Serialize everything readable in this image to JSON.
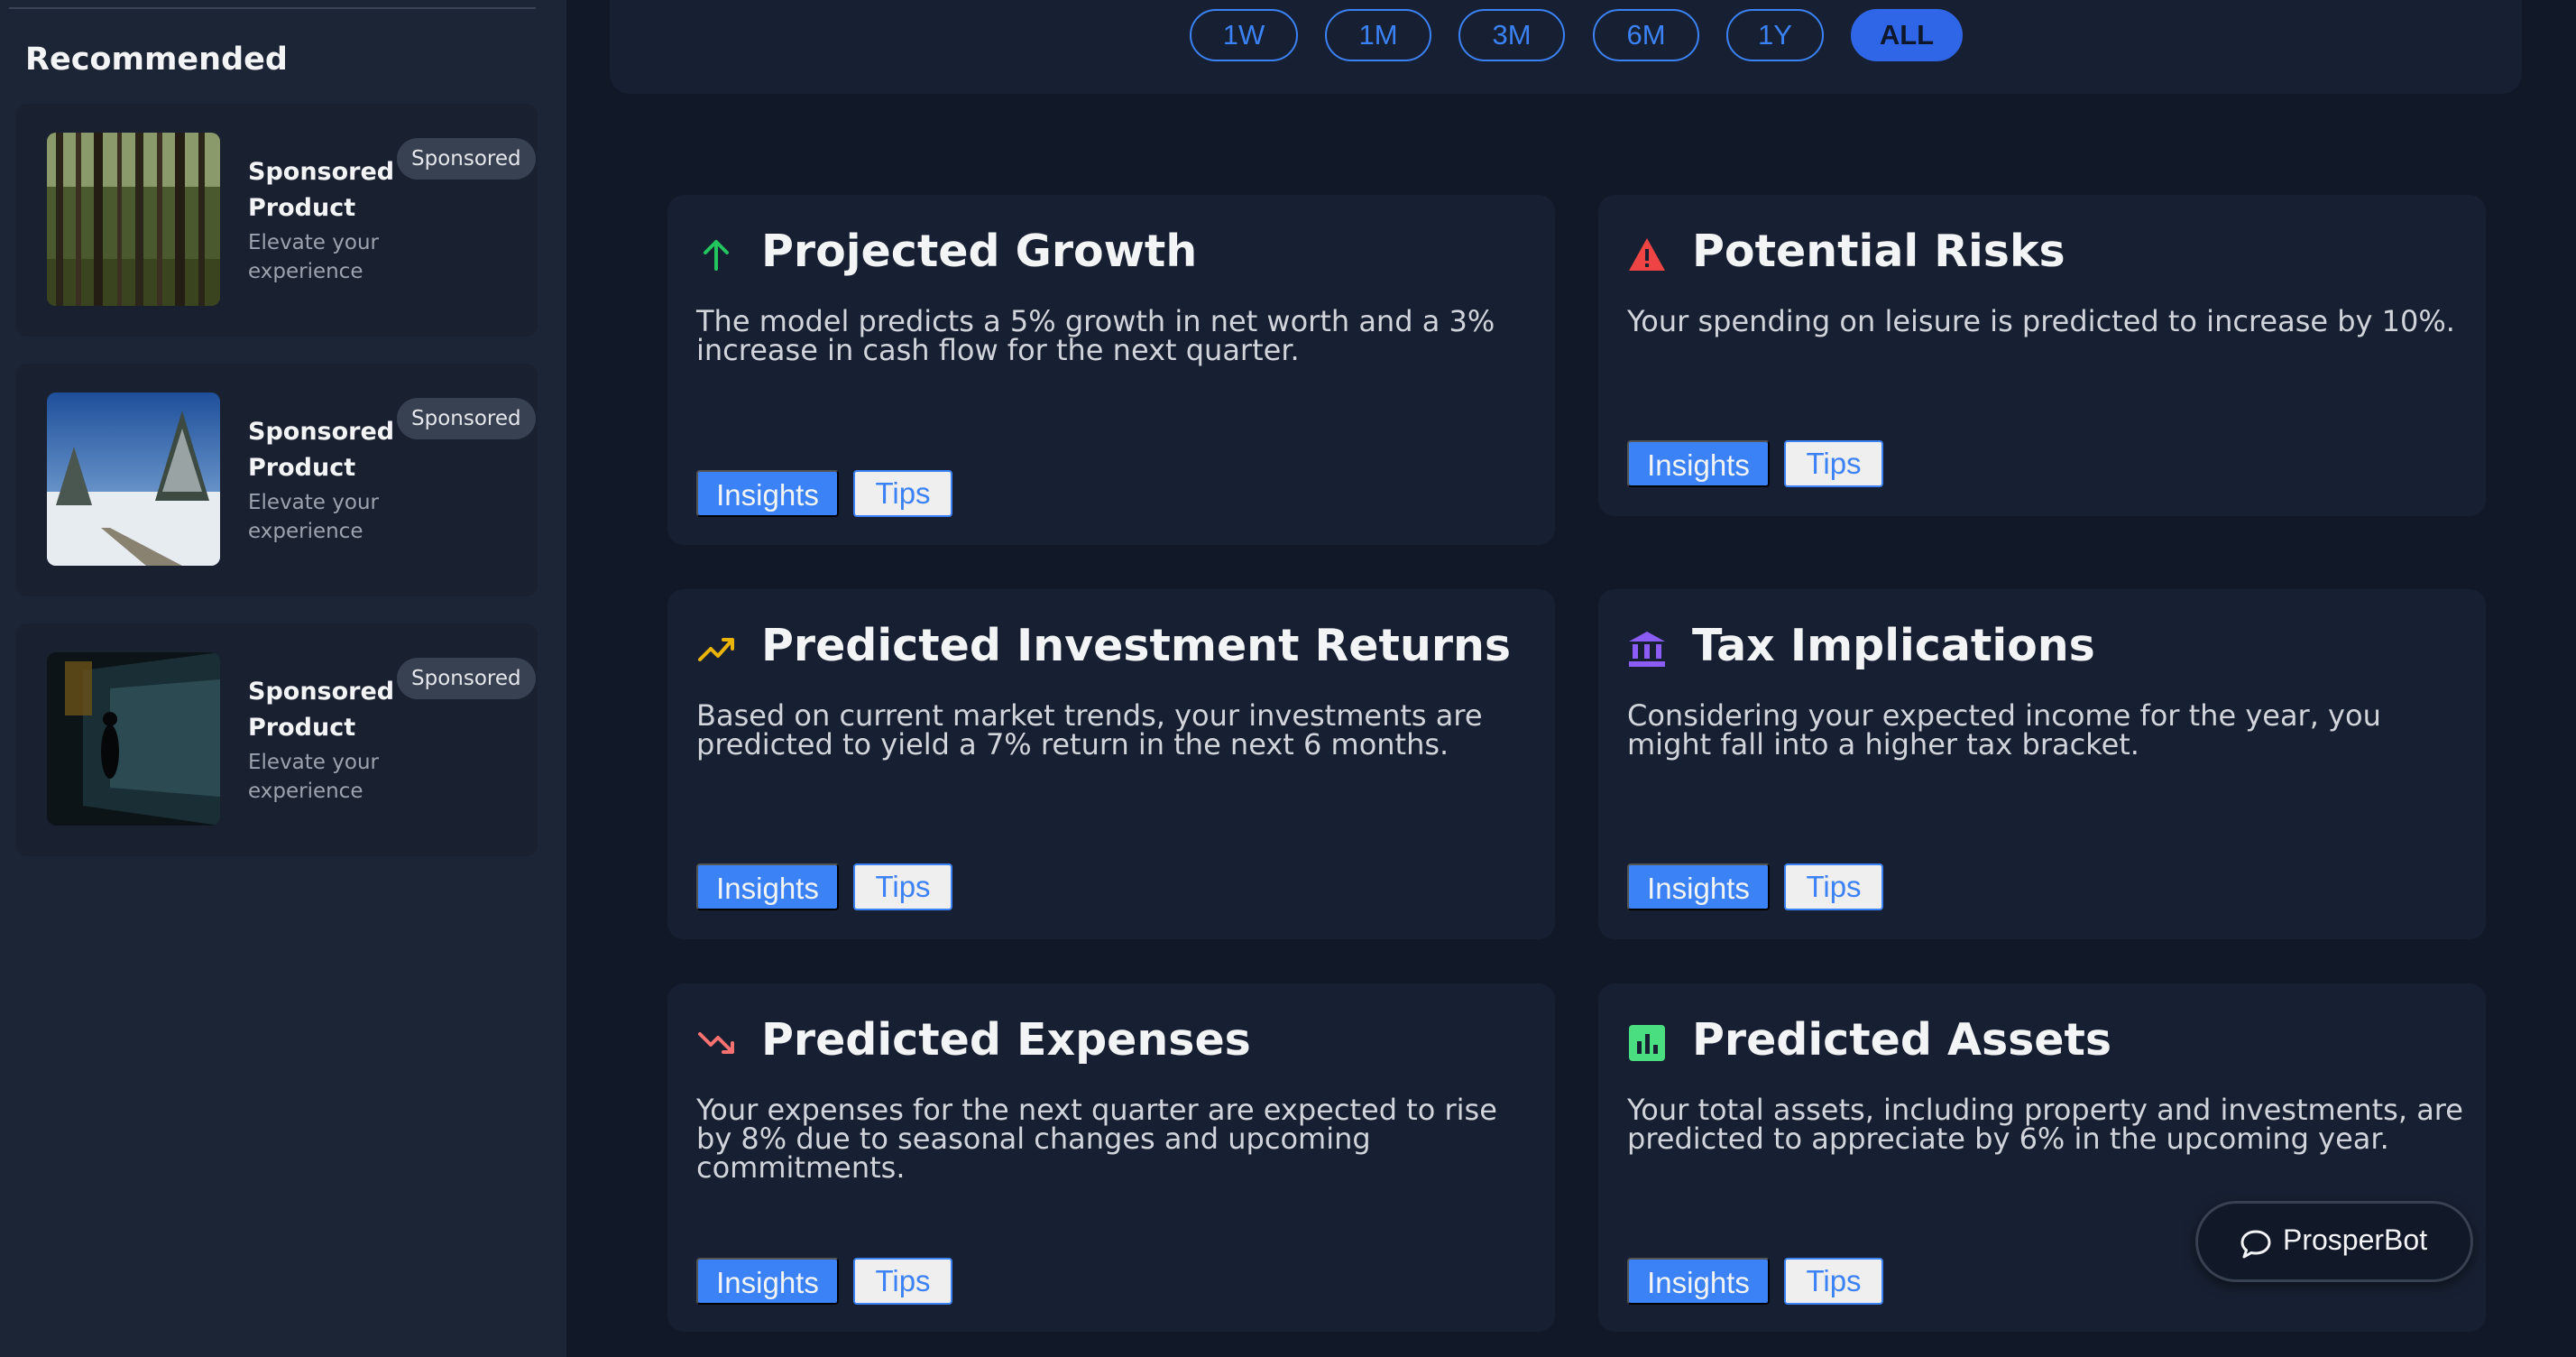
{
  "sidebar": {
    "title": "Recommended",
    "ads": [
      {
        "title": "Sponsored Product",
        "subtitle": "Elevate your experience",
        "badge": "Sponsored",
        "image": "forest-image"
      },
      {
        "title": "Sponsored Product",
        "subtitle": "Elevate your experience",
        "badge": "Sponsored",
        "image": "snowy-landscape-image"
      },
      {
        "title": "Sponsored Product",
        "subtitle": "Elevate your experience",
        "badge": "Sponsored",
        "image": "tunnel-image"
      }
    ]
  },
  "timeframes": {
    "options": [
      "1W",
      "1M",
      "3M",
      "6M",
      "1Y",
      "ALL"
    ],
    "selected": "ALL"
  },
  "cards": [
    {
      "icon": "arrow-up-icon",
      "title": "Projected Growth",
      "body": "The model predicts a 5% growth in net worth and a 3% increase in cash flow for the next quarter.",
      "insights_label": "Insights",
      "tips_label": "Tips"
    },
    {
      "icon": "warning-icon",
      "title": "Potential Risks",
      "body": "Your spending on leisure is predicted to increase by 10%.",
      "insights_label": "Insights",
      "tips_label": "Tips"
    },
    {
      "icon": "trending-up-icon",
      "title": "Predicted Investment Returns",
      "body": "Based on current market trends, your investments are predicted to yield a 7% return in the next 6 months.",
      "insights_label": "Insights",
      "tips_label": "Tips"
    },
    {
      "icon": "bank-icon",
      "title": "Tax Implications",
      "body": "Considering your expected income for the year, you might fall into a higher tax bracket.",
      "insights_label": "Insights",
      "tips_label": "Tips"
    },
    {
      "icon": "trending-down-icon",
      "title": "Predicted Expenses",
      "body": "Your expenses for the next quarter are expected to rise by 8% due to seasonal changes and upcoming commitments.",
      "insights_label": "Insights",
      "tips_label": "Tips"
    },
    {
      "icon": "bar-chart-icon",
      "title": "Predicted Assets",
      "body": "Your total assets, including property and investments, are predicted to appreciate by 6% in the upcoming year.",
      "insights_label": "Insights",
      "tips_label": "Tips"
    }
  ],
  "chatbot": {
    "label": "ProsperBot",
    "icon": "chat-bubble-icon"
  },
  "colors": {
    "background": "#111827",
    "sidebar": "#1c2536",
    "card": "#172032",
    "accent": "#3b82f6",
    "growth_icon": "#22c55e",
    "risk_icon": "#ef4444",
    "investment_icon": "#eab308",
    "tax_icon": "#8b5cf6",
    "expense_icon": "#f87171",
    "assets_icon": "#4ade80"
  }
}
